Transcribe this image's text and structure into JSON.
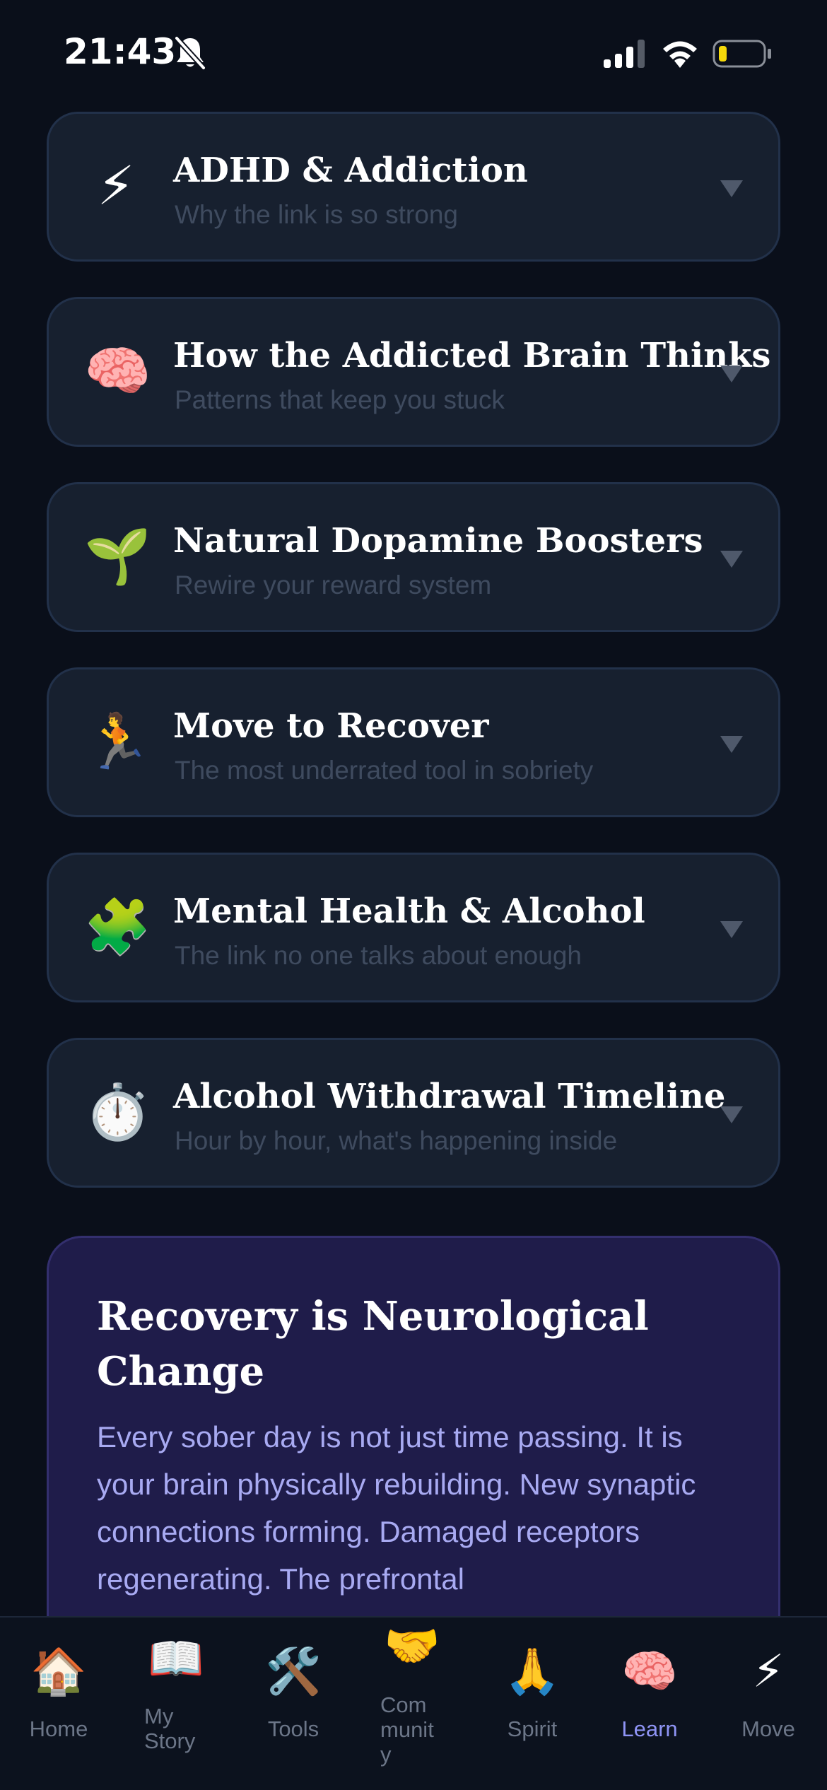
{
  "status_bar": {
    "time": "21:43",
    "icons": [
      "bell-slash-icon",
      "signal-icon",
      "wifi-icon",
      "battery-icon"
    ]
  },
  "cards": [
    {
      "icon": "⚡",
      "icon_name": "lightning-icon",
      "title": "ADHD & Addiction",
      "subtitle": "Why the link is so strong"
    },
    {
      "icon": "🧠",
      "icon_name": "brain-icon",
      "title": "How the Addicted Brain Thinks",
      "subtitle": "Patterns that keep you stuck"
    },
    {
      "icon": "🌱",
      "icon_name": "seedling-icon",
      "title": "Natural Dopamine Boosters",
      "subtitle": "Rewire your reward system"
    },
    {
      "icon": "🏃",
      "icon_name": "runner-icon",
      "title": "Move to Recover",
      "subtitle": "The most underrated tool in sobriety"
    },
    {
      "icon": "🧩",
      "icon_name": "puzzle-icon",
      "title": "Mental Health & Alcohol",
      "subtitle": "The link no one talks about enough"
    },
    {
      "icon": "⏱️",
      "icon_name": "stopwatch-icon",
      "title": "Alcohol Withdrawal Timeline",
      "subtitle": "Hour by hour, what's happening inside"
    }
  ],
  "info_panel": {
    "title": "Recovery is Neurological Change",
    "body": "Every sober day is not just time passing. It is your brain physically rebuilding. New synaptic connections forming. Damaged receptors regenerating. The prefrontal"
  },
  "nav": [
    {
      "icon": "🏠",
      "icon_name": "home-icon",
      "label": "Home"
    },
    {
      "icon": "📖",
      "icon_name": "book-icon",
      "label": "My\nStory"
    },
    {
      "icon": "🛠️",
      "icon_name": "tools-icon",
      "label": "Tools"
    },
    {
      "icon": "🤝",
      "icon_name": "handshake-icon",
      "label": "Com\nmunit\ny"
    },
    {
      "icon": "🙏",
      "icon_name": "praying-hands-icon",
      "label": "Spirit"
    },
    {
      "icon": "🧠",
      "icon_name": "brain-icon",
      "label": "Learn"
    },
    {
      "icon": "⚡",
      "icon_name": "lightning-icon",
      "label": "Move"
    }
  ],
  "colors": {
    "background": "#0a0f1a",
    "card": "#17202f",
    "panel": "#1f1c4a",
    "accent": "#8f94f5",
    "battery_low": "#f5d90a"
  }
}
